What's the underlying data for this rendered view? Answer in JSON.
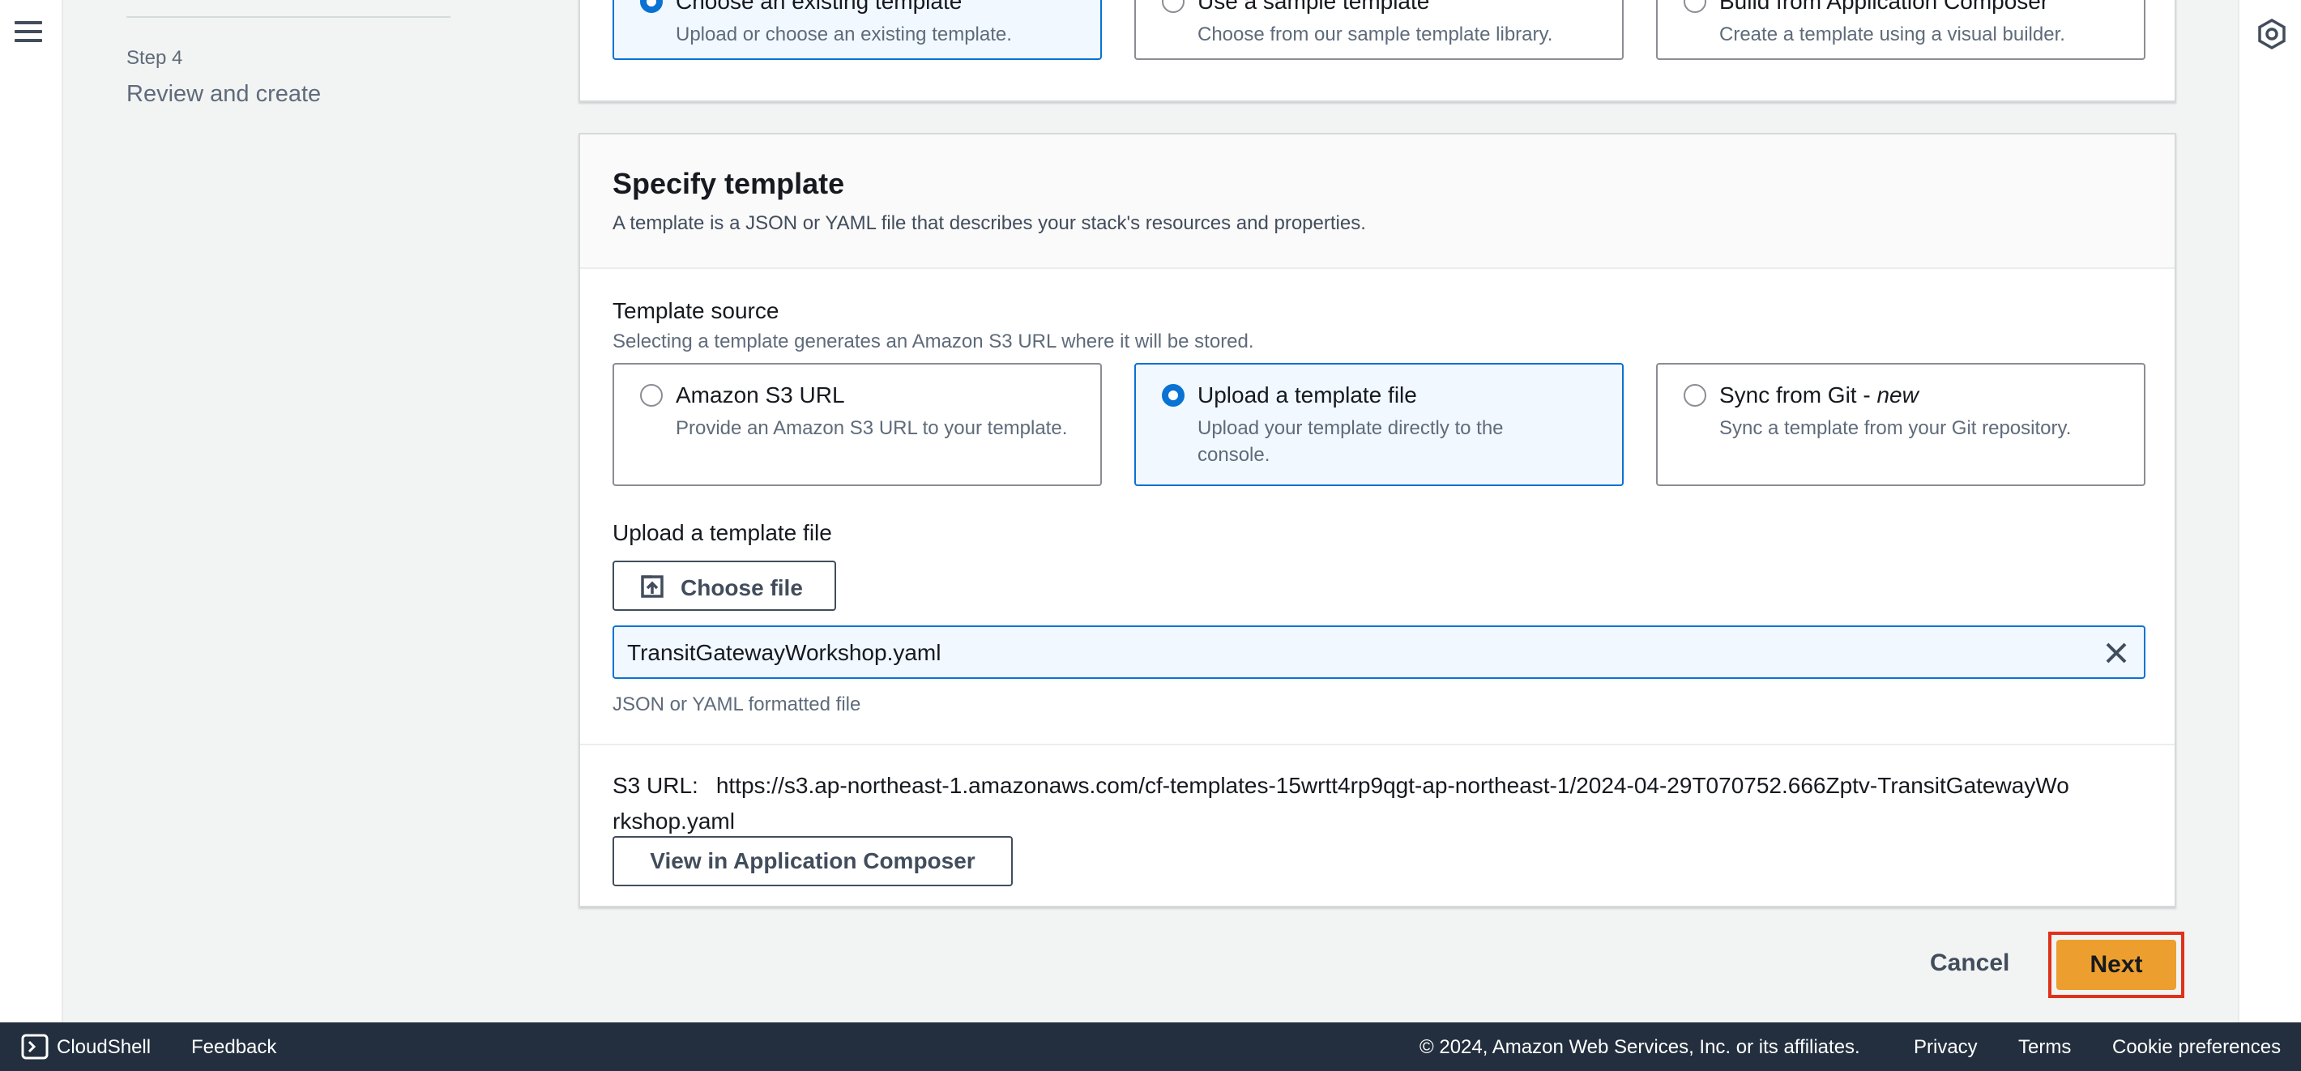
{
  "steps": {
    "step_label": "Step 4",
    "step_title": "Review and create"
  },
  "prepare_template": {
    "options": [
      {
        "title": "Choose an existing template",
        "description": "Upload or choose an existing template.",
        "selected": true
      },
      {
        "title": "Use a sample template",
        "description": "Choose from our sample template library.",
        "selected": false
      },
      {
        "title": "Build from Application Composer",
        "description": "Create a template using a visual builder.",
        "selected": false
      }
    ]
  },
  "specify_template": {
    "title": "Specify template",
    "description": "A template is a JSON or YAML file that describes your stack's resources and properties.",
    "source_label": "Template source",
    "source_description": "Selecting a template generates an Amazon S3 URL where it will be stored.",
    "sources": [
      {
        "title": "Amazon S3 URL",
        "description": "Provide an Amazon S3 URL to your template.",
        "selected": false
      },
      {
        "title": "Upload a template file",
        "description": "Upload your template directly to the console.",
        "selected": true
      },
      {
        "title": "Sync from Git - ",
        "title_suffix": "new",
        "description": "Sync a template from your Git repository.",
        "selected": false
      }
    ],
    "upload_label": "Upload a template file",
    "choose_file_label": "Choose file",
    "file_name": "TransitGatewayWorkshop.yaml",
    "file_hint": "JSON or YAML formatted file",
    "s3_url_key": "S3 URL:",
    "s3_url_value": "https://s3.ap-northeast-1.amazonaws.com/cf-templates-15wrtt4rp9qgt-ap-northeast-1/2024-04-29T070752.666Zptv-TransitGatewayWorkshop.yaml",
    "view_composer_label": "View in Application Composer"
  },
  "actions": {
    "cancel_label": "Cancel",
    "next_label": "Next"
  },
  "footer": {
    "cloudshell_label": "CloudShell",
    "feedback_label": "Feedback",
    "copyright": "© 2024, Amazon Web Services, Inc. or its affiliates.",
    "privacy_label": "Privacy",
    "terms_label": "Terms",
    "cookie_label": "Cookie preferences"
  },
  "colors": {
    "accent": "#0972d3",
    "primary_button": "#ec9f2e",
    "highlight_box": "#e0311b",
    "footer_bg": "#232f3e"
  },
  "icons": [
    "hamburger-menu-icon",
    "settings-hexagon-icon",
    "upload-icon",
    "close-icon",
    "cloudshell-icon"
  ]
}
